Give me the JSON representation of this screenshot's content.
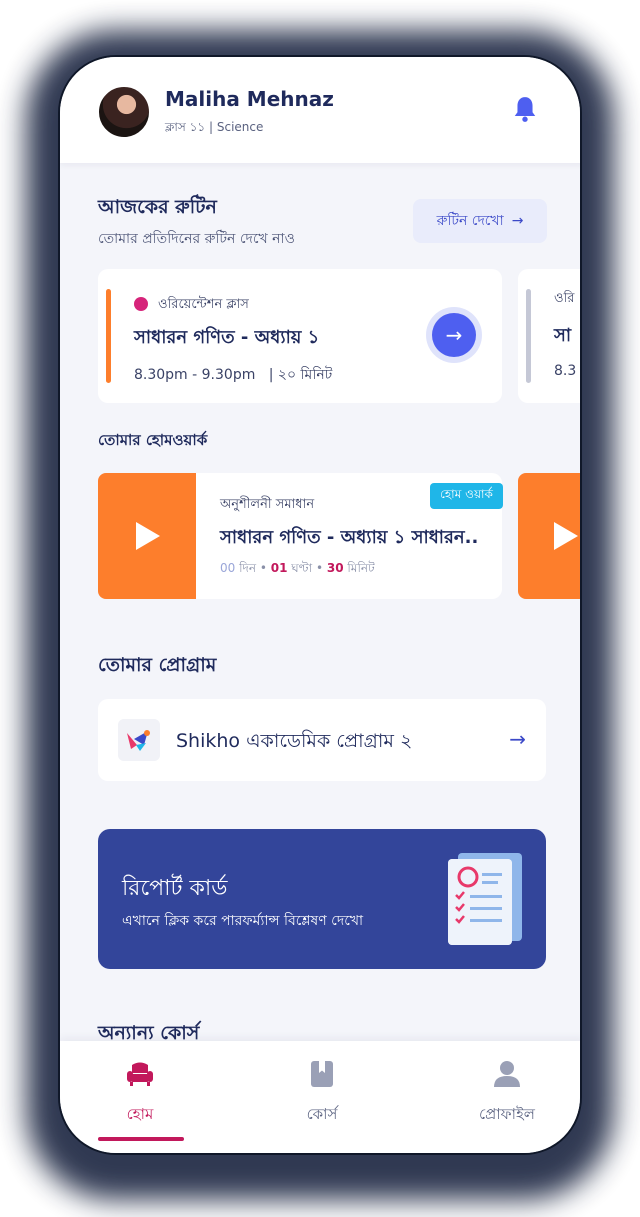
{
  "user": {
    "name": "Maliha Mehnaz",
    "subtitle": "ক্লাস ১১ | Science"
  },
  "routine": {
    "title": "আজকের রুটিন",
    "subtitle": "তোমার প্রতিদিনের রুটিন দেখে নাও",
    "button_label": "রুটিন দেখো",
    "cards": [
      {
        "tag": "ওরিয়েন্টেশন ক্লাস",
        "title": "সাধারন গণিত - অধ্যায় ১",
        "time": "8.30pm - 9.30pm",
        "duration": "২০ মিনিট",
        "accent": "#fd7e2c"
      },
      {
        "tag": "ওরি",
        "title": "সা",
        "time": "8.3",
        "accent": "#c5c8d6"
      }
    ]
  },
  "homework": {
    "title": "তোমার হোমওয়ার্ক",
    "cards": [
      {
        "badge": "হোম ওয়ার্ক",
        "category": "অনুশীলনী সমাধান",
        "title": "সাধারন গণিত - অধ্যায় ১  সাধারন..",
        "days_value": "00",
        "days_label": "দিন",
        "hours_value": "01",
        "hours_label": "ঘণ্টা",
        "minutes_value": "30",
        "minutes_label": "মিনিট"
      }
    ]
  },
  "program": {
    "title": "তোমার প্রোগ্রাম",
    "name": "Shikho একাডেমিক প্রোগ্রাম ২"
  },
  "report": {
    "title": "রিপোর্ট কার্ড",
    "subtitle": "এখানে ক্লিক করে পারফর্ম্যান্স বিশ্লেষণ দেখো"
  },
  "other_courses": {
    "title": "অন্যান্য কোর্স"
  },
  "nav": {
    "items": [
      {
        "label": "হোম",
        "icon": "sofa-icon",
        "active": true
      },
      {
        "label": "কোর্স",
        "icon": "book-icon",
        "active": false
      },
      {
        "label": "প্রোফাইল",
        "icon": "person-icon",
        "active": false
      }
    ]
  },
  "colors": {
    "primary": "#3b49c8",
    "accent_pink": "#c2185b",
    "orange": "#fd7e2c",
    "report_bg": "#33459a",
    "badge": "#1fb6e8"
  }
}
